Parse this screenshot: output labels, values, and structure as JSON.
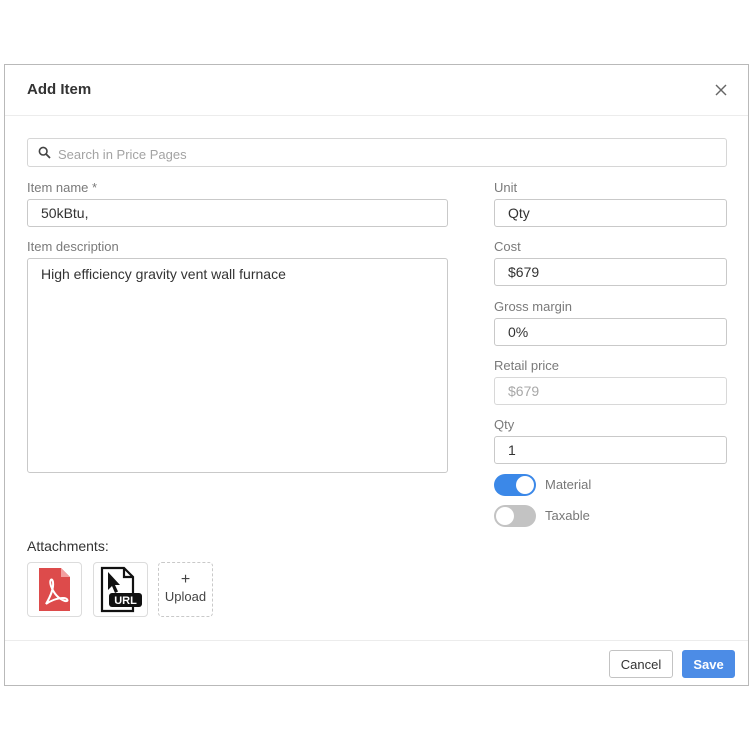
{
  "dialog": {
    "title": "Add Item",
    "search": {
      "placeholder": "Search in Price Pages",
      "value": ""
    },
    "item_name": {
      "label": "Item name *",
      "value": "50kBtu,"
    },
    "item_description": {
      "label": "Item description",
      "value": "High efficiency gravity vent wall furnace"
    },
    "unit": {
      "label": "Unit",
      "value": "Qty"
    },
    "cost": {
      "label": "Cost",
      "value": "$679"
    },
    "gross_margin": {
      "label": "Gross margin",
      "value": "0%"
    },
    "retail_price": {
      "label": "Retail price",
      "value": "$679"
    },
    "qty": {
      "label": "Qty",
      "value": "1"
    },
    "toggles": [
      {
        "label": "Material",
        "on": true
      },
      {
        "label": "Taxable",
        "on": false
      }
    ],
    "attachments": {
      "title": "Attachments:",
      "items": [
        {
          "type": "pdf",
          "icon": "pdf-file-icon"
        },
        {
          "type": "url",
          "icon": "url-file-icon",
          "badge": "URL"
        }
      ],
      "upload_label": "Upload",
      "upload_plus": "+"
    },
    "buttons": {
      "cancel": "Cancel",
      "save": "Save"
    },
    "colors": {
      "accent": "#4c8ce6",
      "toggle_on": "#3b88e8",
      "toggle_off": "#c3c3c3",
      "pdf_red": "#dd4b4b"
    }
  }
}
